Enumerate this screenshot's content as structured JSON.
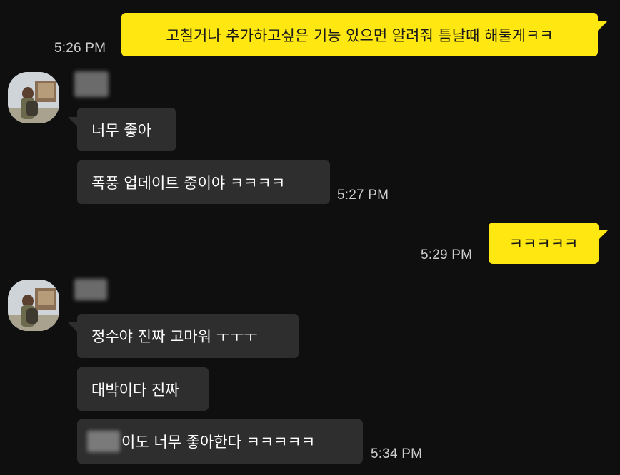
{
  "colors": {
    "background": "#0f0f0f",
    "outgoing_bubble": "#ffe812",
    "incoming_bubble": "#2e2e2e",
    "timestamp": "#cfcfcf"
  },
  "messages": {
    "m1": {
      "text": "고칠거나 추가하고싶은 기능 있으면 알려줘 틈날때 해둘게ㅋㅋ",
      "time": "5:26 PM"
    },
    "g1": {
      "b1": "너무 좋아",
      "b2": "폭풍 업데이트 중이야 ㅋㅋㅋㅋ",
      "time": "5:27 PM"
    },
    "m2": {
      "text": "ㅋㅋㅋㅋㅋ",
      "time": "5:29 PM"
    },
    "g2": {
      "b1": "정수야 진짜 고마워 ㅜㅜㅜ",
      "b2": "대박이다 진짜",
      "b3": "이도 너무 좋아한다 ㅋㅋㅋㅋㅋ",
      "time": "5:34 PM"
    }
  }
}
